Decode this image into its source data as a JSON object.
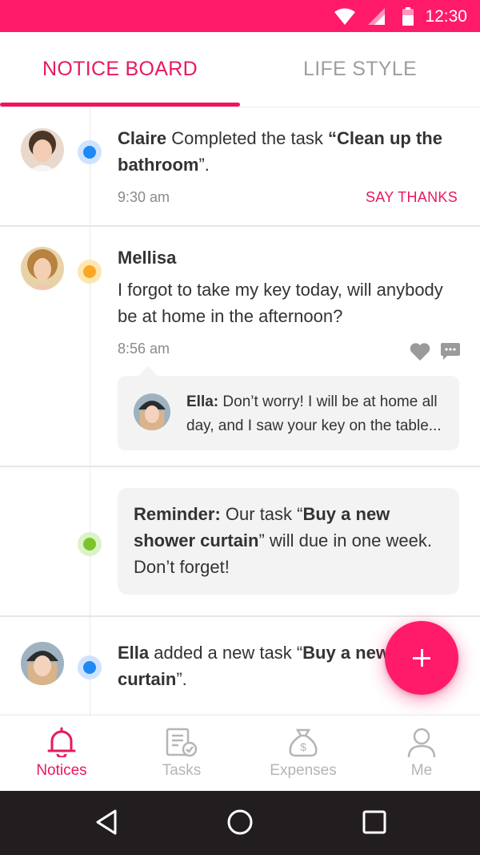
{
  "status_bar": {
    "time": "12:30"
  },
  "tabs": [
    {
      "label": "NOTICE BOARD",
      "active": true
    },
    {
      "label": "LIFE STYLE",
      "active": false
    }
  ],
  "feed": {
    "items": [
      {
        "actor": "Claire",
        "verb": " Completed the task ",
        "quote_open": "“",
        "task": "Clean up the bathroom",
        "quote_close": "”.",
        "time": "9:30 am",
        "action": "SAY THANKS",
        "dot_color": "#1e88f5"
      },
      {
        "actor": "Mellisa",
        "message": "I forgot to take my key today, will anybody be at home in the afternoon?",
        "time": "8:56 am",
        "dot_color": "#f9a825",
        "reply": {
          "author": "Ella:",
          "text": " Don’t worry! I will be at home all day, and I saw your key on the table..."
        }
      },
      {
        "label": "Reminder:",
        "pre": " Our task “",
        "task": "Buy a new shower curtain",
        "post": "” will due in one week. Don’t forget!",
        "dot_color": "#7cc42a"
      },
      {
        "actor": "Ella",
        "verb": " added a new task “",
        "task": "Buy a new shower curtain",
        "quote_close": "”.",
        "dot_color": "#1e88f5"
      }
    ]
  },
  "fab": {
    "icon": "plus-icon"
  },
  "bottom_nav": [
    {
      "label": "Notices",
      "icon": "bell-icon",
      "active": true
    },
    {
      "label": "Tasks",
      "icon": "task-list-icon",
      "active": false
    },
    {
      "label": "Expenses",
      "icon": "money-bag-icon",
      "active": false
    },
    {
      "label": "Me",
      "icon": "person-icon",
      "active": false
    }
  ],
  "colors": {
    "accent": "#ff1a6a",
    "accent_text": "#e8195f",
    "inactive": "#b5b5b5",
    "system_nav": "#221e20"
  }
}
